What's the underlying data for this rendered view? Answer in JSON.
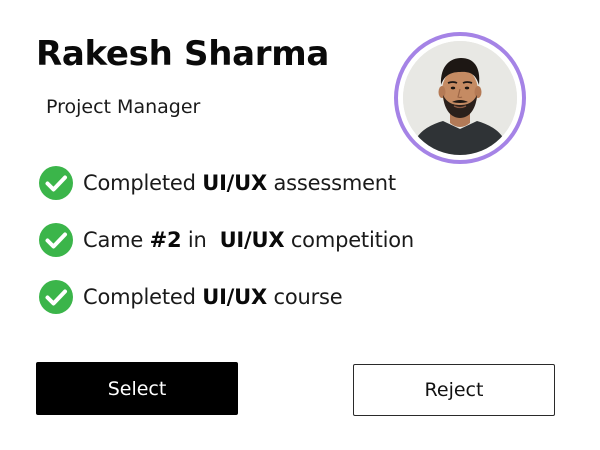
{
  "profile": {
    "name": "Rakesh Sharma",
    "role": "Project Manager",
    "avatar_icon": "person-photo",
    "avatar_ring_color": "#a583e6"
  },
  "achievements": [
    {
      "icon": "check-circle-icon",
      "prefix": "Completed ",
      "highlight": "UI/UX",
      "suffix": " assessment"
    },
    {
      "icon": "check-circle-icon",
      "prefix": "Came ",
      "highlight_rank": "#2",
      "middle": " in  ",
      "highlight": "UI/UX",
      "suffix": " competition"
    },
    {
      "icon": "check-circle-icon",
      "prefix": "Completed ",
      "highlight": "UI/UX",
      "suffix": " course"
    }
  ],
  "check_color": "#3bb54a",
  "actions": {
    "select_label": "Select",
    "reject_label": "Reject"
  }
}
